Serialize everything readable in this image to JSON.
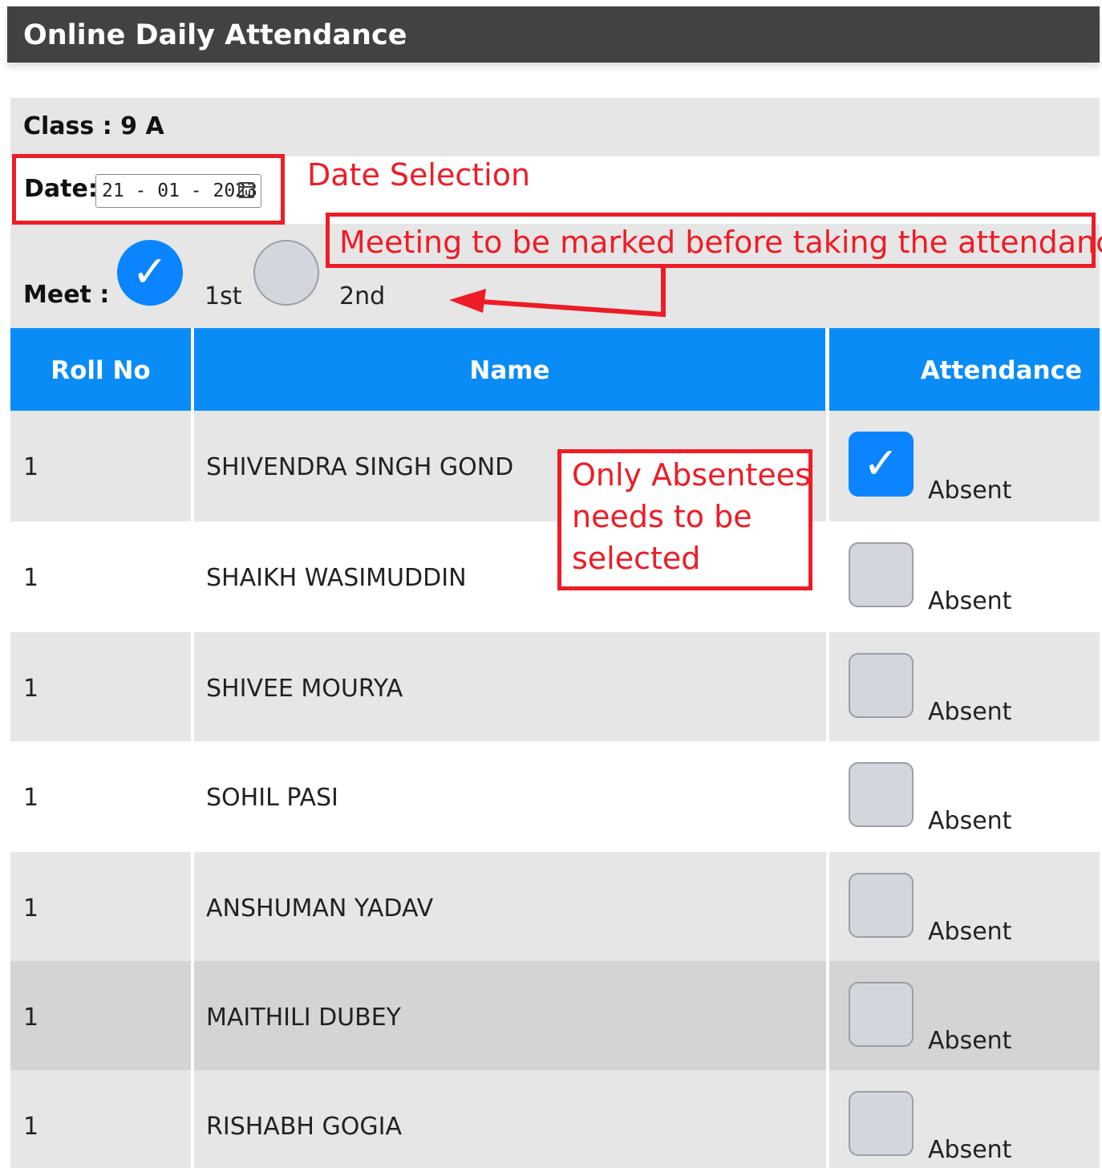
{
  "header": {
    "title": "Online Daily Attendance"
  },
  "class_info": {
    "label": "Class : 9 A"
  },
  "date": {
    "label": "Date:",
    "value": "21 - 01 - 2023"
  },
  "meet": {
    "label": "Meet :",
    "options": [
      {
        "label": "1st",
        "selected": true
      },
      {
        "label": "2nd",
        "selected": false
      }
    ]
  },
  "table": {
    "headers": {
      "roll": "Roll No",
      "name": "Name",
      "attendance": "Attendance"
    },
    "rows": [
      {
        "roll": "1",
        "name": "SHIVENDRA SINGH GOND",
        "absent_label": "Absent",
        "checked": true
      },
      {
        "roll": "1",
        "name": "SHAIKH WASIMUDDIN",
        "absent_label": "Absent",
        "checked": false
      },
      {
        "roll": "1",
        "name": "SHIVEE MOURYA",
        "absent_label": "Absent",
        "checked": false
      },
      {
        "roll": "1",
        "name": "SOHIL PASI",
        "absent_label": "Absent",
        "checked": false
      },
      {
        "roll": "1",
        "name": "ANSHUMAN YADAV",
        "absent_label": "Absent",
        "checked": false
      },
      {
        "roll": "1",
        "name": "MAITHILI DUBEY",
        "absent_label": "Absent",
        "checked": false
      },
      {
        "roll": "1",
        "name": "RISHABH GOGIA",
        "absent_label": "Absent",
        "checked": false
      }
    ]
  },
  "annotations": {
    "date_selection": "Date Selection",
    "meeting_note": "Meeting to be marked before taking the attendance",
    "absentees_line1": "Only Absentees",
    "absentees_line2": "needs to be",
    "absentees_line3": "selected"
  },
  "colors": {
    "titlebar": "#424242",
    "table_header": "#0a8cf7",
    "checked": "#0a84ff",
    "annotation": "#ee1c25",
    "row_grey": "#e6e6e6",
    "row_dark": "#d4d4d4"
  }
}
